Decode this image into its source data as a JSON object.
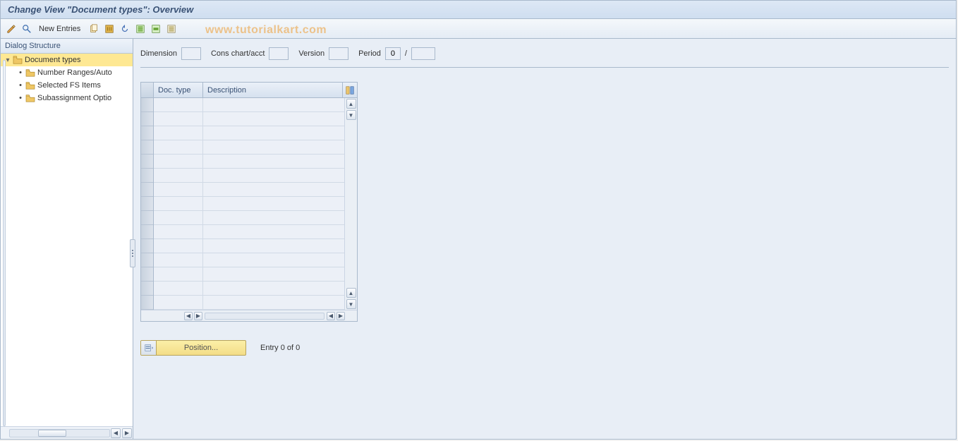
{
  "title": "Change View \"Document types\": Overview",
  "watermark": "www.tutorialkart.com",
  "toolbar": {
    "new_entries": "New Entries"
  },
  "dialog_structure": {
    "header": "Dialog Structure",
    "root": {
      "label": "Document types",
      "expanded": true,
      "selected": true
    },
    "children": [
      {
        "label": "Number Ranges/Auto"
      },
      {
        "label": "Selected FS Items"
      },
      {
        "label": "Subassignment Optio"
      }
    ]
  },
  "header_fields": {
    "dimension": {
      "label": "Dimension",
      "value": ""
    },
    "cons_chart": {
      "label": "Cons chart/acct",
      "value": ""
    },
    "version": {
      "label": "Version",
      "value": ""
    },
    "period": {
      "label": "Period",
      "value1": "0",
      "sep": "/",
      "value2": ""
    }
  },
  "table": {
    "columns": [
      {
        "key": "doc_type",
        "label": "Doc. type"
      },
      {
        "key": "description",
        "label": "Description"
      }
    ],
    "rows": 15
  },
  "footer": {
    "position_label": "Position...",
    "entry_text": "Entry 0 of 0"
  }
}
